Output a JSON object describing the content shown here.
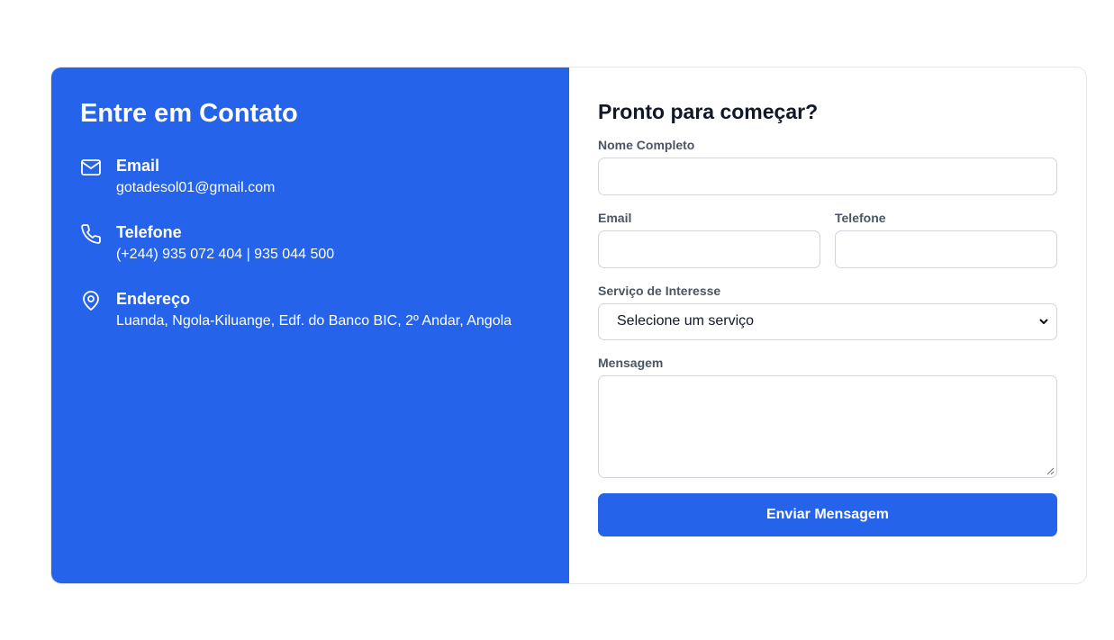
{
  "contact": {
    "title": "Entre em Contato",
    "items": [
      {
        "icon": "mail-icon",
        "title": "Email",
        "value": "gotadesol01@gmail.com"
      },
      {
        "icon": "phone-icon",
        "title": "Telefone",
        "value": "(+244) 935 072 404 | 935 044 500"
      },
      {
        "icon": "map-pin-icon",
        "title": "Endereço",
        "value": "Luanda, Ngola-Kiluange, Edf. do Banco BIC, 2º Andar, Angola"
      }
    ]
  },
  "form": {
    "title": "Pronto para começar?",
    "name_label": "Nome Completo",
    "email_label": "Email",
    "phone_label": "Telefone",
    "service_label": "Serviço de Interesse",
    "service_selected": "Selecione um serviço",
    "message_label": "Mensagem",
    "submit_label": "Enviar Mensagem"
  },
  "colors": {
    "primary": "#2563eb",
    "heading": "#111827",
    "label": "#4b5563",
    "border": "#d1d5db"
  }
}
